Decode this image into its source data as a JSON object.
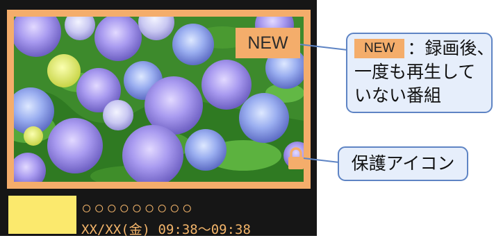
{
  "tile": {
    "new_badge": "NEW",
    "program_title": "○○○○○○○○○",
    "program_datetime": "XX/XX(金) 09:38～09:38",
    "colors": {
      "frame": "#f4ad6b",
      "tile_background": "#161616",
      "text": "#f2b46a",
      "swatch": "#fbe96d"
    },
    "thumbnail_subject": "hydrangea",
    "icons": [
      "lock-icon"
    ]
  },
  "callouts": {
    "new": {
      "badge": "NEW",
      "line1": "：録画後、",
      "line2": "一度も再生して",
      "line3": "いない番組"
    },
    "protect": {
      "label": "保護アイコン"
    },
    "colors": {
      "border": "#5e84c4",
      "background": "#e6eefb"
    }
  }
}
